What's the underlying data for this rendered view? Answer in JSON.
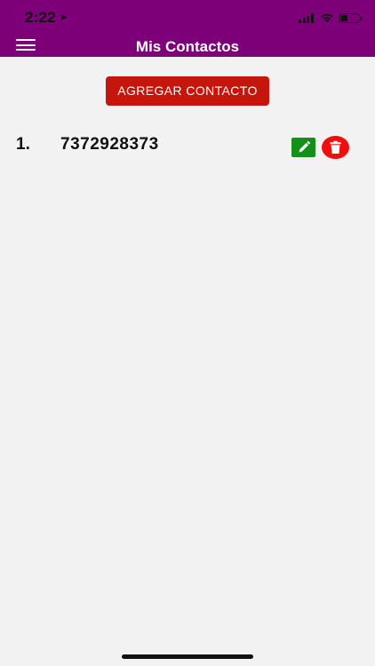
{
  "status_bar": {
    "time": "2:22",
    "location_glyph": "➤",
    "battery_level": 0.4
  },
  "header": {
    "title": "Mis Contactos",
    "background": "#7d0079"
  },
  "add_button": {
    "label": "AGREGAR CONTACTO",
    "color": "#c4160c"
  },
  "contacts": [
    {
      "index": "1.",
      "phone": "7372928373"
    }
  ],
  "icons": {
    "menu": "hamburger-menu-icon",
    "edit": "pencil-icon",
    "delete": "trash-icon"
  },
  "colors": {
    "edit": "#138f1a",
    "delete": "#f00f0f",
    "background": "#f2f2f2"
  }
}
